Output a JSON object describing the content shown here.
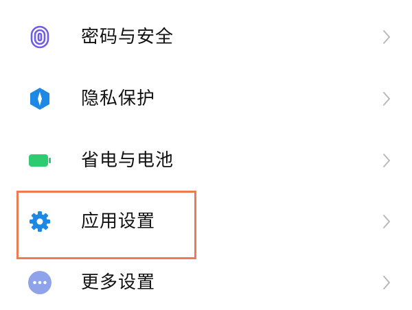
{
  "settings_list": {
    "items": [
      {
        "label": "密码与安全",
        "icon": "fingerprint-icon",
        "icon_color": "#6c5ce7"
      },
      {
        "label": "隐私保护",
        "icon": "privacy-shield-icon",
        "icon_color": "#1e88e5"
      },
      {
        "label": "省电与电池",
        "icon": "battery-icon",
        "icon_color": "#2ecc71"
      },
      {
        "label": "应用设置",
        "icon": "gear-icon",
        "icon_color": "#1e88e5"
      },
      {
        "label": "更多设置",
        "icon": "more-dots-icon",
        "icon_color": "#8ea3ea"
      }
    ]
  },
  "highlight": {
    "color": "#ee7a52",
    "target": "应用设置"
  }
}
